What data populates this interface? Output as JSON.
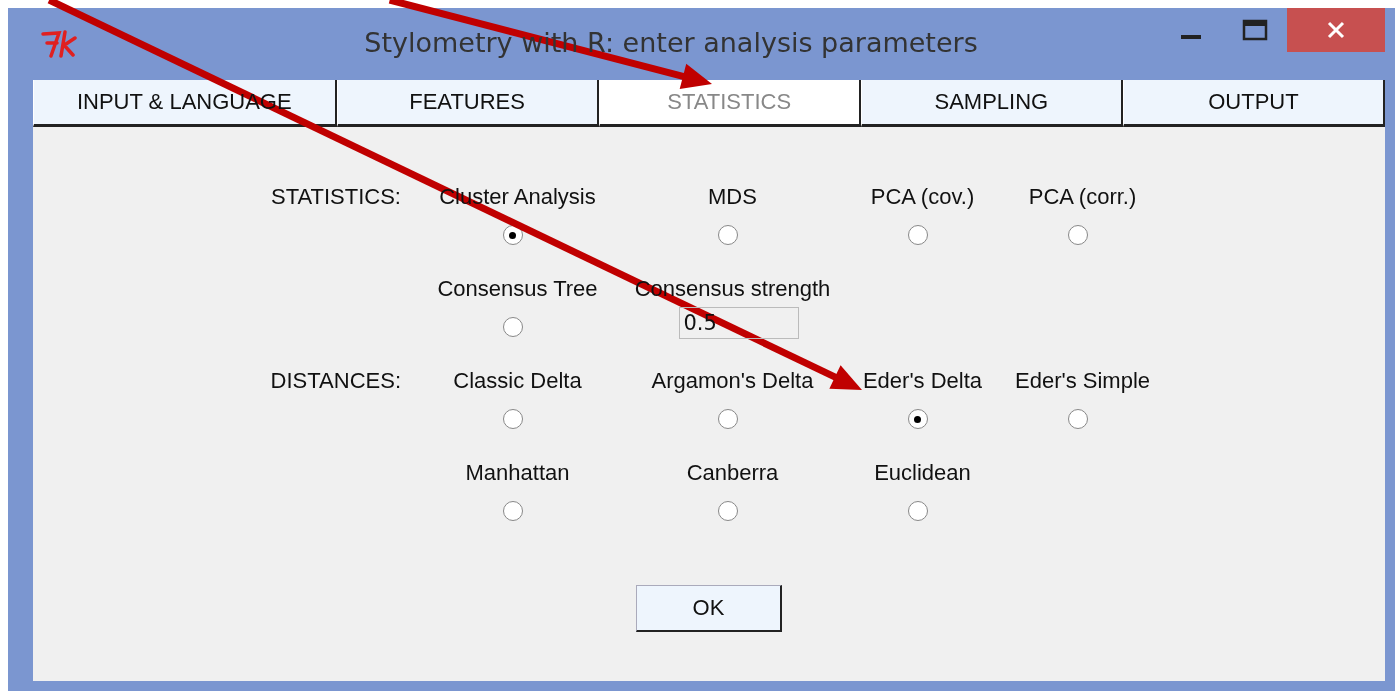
{
  "window": {
    "title": "Stylometry with R: enter analysis parameters"
  },
  "tabs": [
    {
      "label": "INPUT & LANGUAGE",
      "selected": false
    },
    {
      "label": "FEATURES",
      "selected": false
    },
    {
      "label": "STATISTICS",
      "selected": true
    },
    {
      "label": "SAMPLING",
      "selected": false
    },
    {
      "label": "OUTPUT",
      "selected": false
    }
  ],
  "sections": [
    {
      "label": "STATISTICS:",
      "items": [
        {
          "kind": "radio",
          "label": "Cluster Analysis",
          "selected": true
        },
        {
          "kind": "radio",
          "label": "MDS",
          "selected": false
        },
        {
          "kind": "radio",
          "label": "PCA (cov.)",
          "selected": false
        },
        {
          "kind": "radio",
          "label": "PCA (corr.)",
          "selected": false
        },
        {
          "kind": "radio",
          "label": "Consensus Tree",
          "selected": false
        },
        {
          "kind": "entry",
          "label": "Consensus strength",
          "value": "0.5"
        }
      ]
    },
    {
      "label": "DISTANCES:",
      "items": [
        {
          "kind": "radio",
          "label": "Classic Delta",
          "selected": false
        },
        {
          "kind": "radio",
          "label": "Argamon's Delta",
          "selected": false
        },
        {
          "kind": "radio",
          "label": "Eder's Delta",
          "selected": true
        },
        {
          "kind": "radio",
          "label": "Eder's Simple",
          "selected": false
        },
        {
          "kind": "radio",
          "label": "Manhattan",
          "selected": false
        },
        {
          "kind": "radio",
          "label": "Canberra",
          "selected": false
        },
        {
          "kind": "radio",
          "label": "Euclidean",
          "selected": false
        }
      ]
    }
  ],
  "buttons": [
    "OK"
  ],
  "annotations": [
    {
      "kind": "arrow",
      "color": "#c00000"
    },
    {
      "kind": "arrow",
      "color": "#c00000"
    }
  ]
}
